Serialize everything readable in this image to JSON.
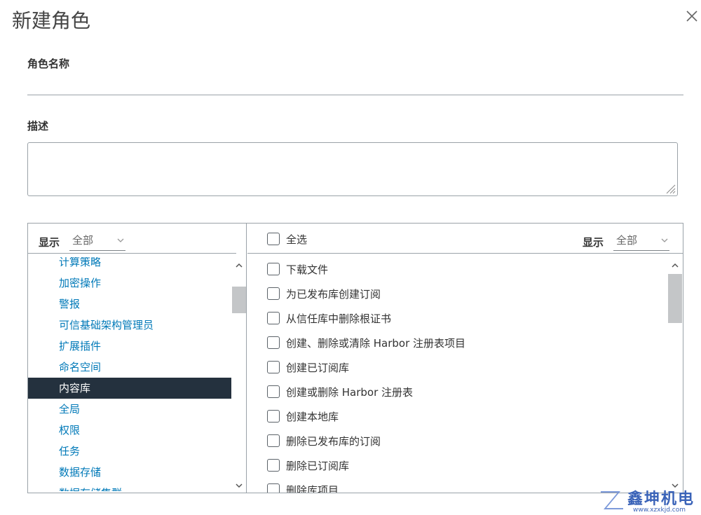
{
  "dialog": {
    "title": "新建角色",
    "close_icon": "close-icon"
  },
  "form": {
    "role_name_label": "角色名称",
    "role_name_value": "",
    "description_label": "描述",
    "description_value": ""
  },
  "left_panel": {
    "filter_label": "显示",
    "filter_value": "全部",
    "categories": [
      "计算策略",
      "加密操作",
      "警报",
      "可信基础架构管理员",
      "扩展插件",
      "命名空间",
      "内容库",
      "全局",
      "权限",
      "任务",
      "数据存储",
      "数据存储集群"
    ],
    "selected_index": 6
  },
  "right_panel": {
    "select_all_label": "全选",
    "filter_label": "显示",
    "filter_value": "全部",
    "privileges": [
      "下载文件",
      "为已发布库创建订阅",
      "从信任库中删除根证书",
      "创建、删除或清除 Harbor 注册表项目",
      "创建已订阅库",
      "创建或删除 Harbor 注册表",
      "创建本地库",
      "删除已发布库的订阅",
      "删除已订阅库",
      "删除库项目"
    ]
  },
  "watermark": {
    "brand": "鑫坤机电",
    "url": "www.xzxkjd.com"
  },
  "colors": {
    "link": "#0079b8",
    "selected_bg": "#24313e",
    "border": "#9aa2a8",
    "watermark": "#3a63b8"
  }
}
